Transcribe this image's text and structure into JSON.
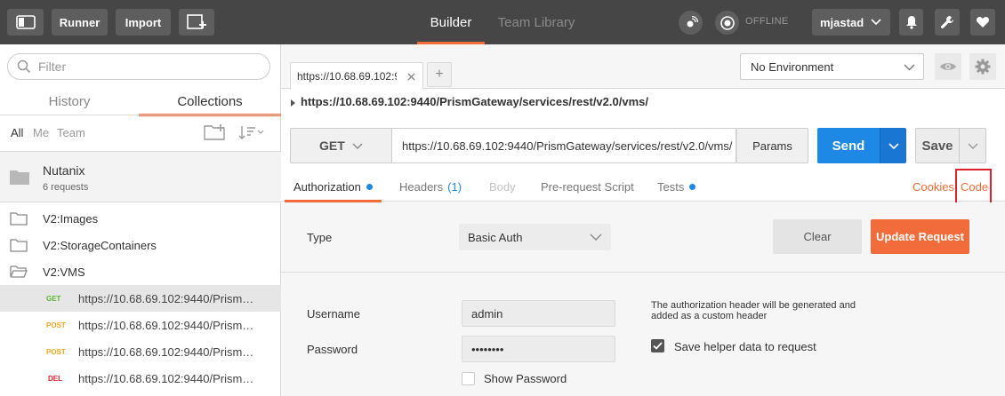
{
  "topbar": {
    "runner_label": "Runner",
    "import_label": "Import",
    "tabs": [
      {
        "label": "Builder",
        "active": true
      },
      {
        "label": "Team Library",
        "active": false
      }
    ],
    "status": "OFFLINE",
    "user": "mjastad"
  },
  "sidebar": {
    "filter_placeholder": "Filter",
    "tabs": [
      {
        "label": "History",
        "active": false
      },
      {
        "label": "Collections",
        "active": true
      }
    ],
    "scopes": [
      "All",
      "Me",
      "Team"
    ],
    "collection": {
      "name": "Nutanix",
      "meta": "6 requests"
    },
    "folders": [
      {
        "label": "V2:Images"
      },
      {
        "label": "V2:StorageContainers"
      },
      {
        "label": "V2:VMS"
      }
    ],
    "requests": [
      {
        "method": "GET",
        "url": "https://10.68.69.102:9440/Prism…",
        "selected": true
      },
      {
        "method": "POST",
        "url": "https://10.68.69.102:9440/Prism…",
        "selected": false
      },
      {
        "method": "POST",
        "url": "https://10.68.69.102:9440/Prism…",
        "selected": false
      },
      {
        "method": "DEL",
        "url": "https://10.68.69.102:9440/Prism…",
        "selected": false
      }
    ],
    "method_colors": {
      "GET": "#5cb531",
      "POST": "#f5a623",
      "DEL": "#e0202a"
    }
  },
  "main": {
    "tab_label": "https://10.68.69.102:9",
    "add_tab_label": "+",
    "environment": "No Environment",
    "request_url_title": "https://10.68.69.102:9440/PrismGateway/services/rest/v2.0/vms/",
    "method": "GET",
    "url": "https://10.68.69.102:9440/PrismGateway/services/rest/v2.0/vms/",
    "params_label": "Params",
    "send_label": "Send",
    "save_label": "Save",
    "sub_tabs": [
      {
        "label": "Authorization",
        "dot": true
      },
      {
        "label": "Headers",
        "count": "(1)"
      },
      {
        "label": "Body",
        "disabled": true
      },
      {
        "label": "Pre-request Script"
      },
      {
        "label": "Tests",
        "dot": true
      }
    ],
    "cookies_label": "Cookies",
    "code_label": "Code",
    "auth": {
      "type_label": "Type",
      "type_value": "Basic Auth",
      "clear_label": "Clear",
      "update_label": "Update Request",
      "username_label": "Username",
      "username_value": "admin",
      "password_label": "Password",
      "password_value": "••••••••",
      "note": "The authorization header will be generated and added as a custom header",
      "save_helper_label": "Save helper data to request",
      "save_helper_checked": true,
      "show_password_label": "Show Password",
      "show_password_checked": false
    }
  },
  "colors": {
    "accent": "#f26b3a",
    "send": "#1e88e5",
    "topbar": "#464646",
    "highlight": "#e0202a"
  }
}
